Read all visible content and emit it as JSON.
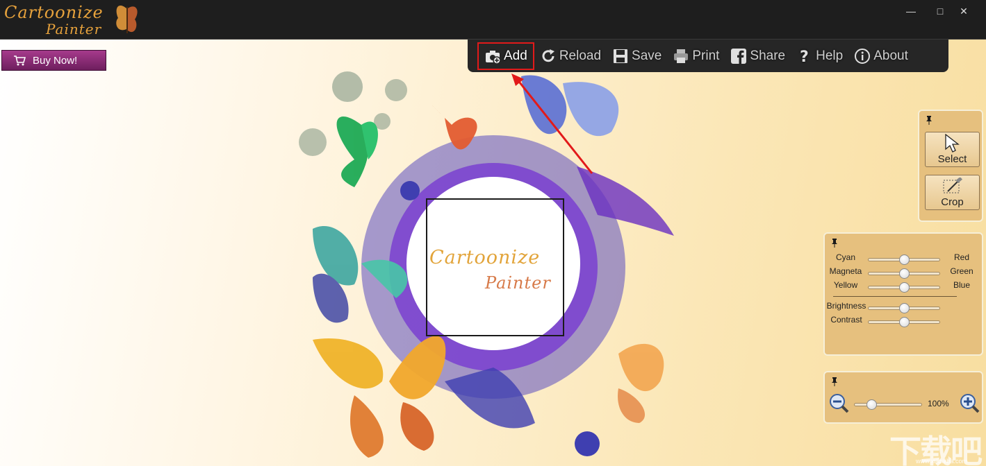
{
  "app": {
    "logo_line1": "Cartoonize",
    "logo_line2": "Painter",
    "window_controls": [
      "minimize",
      "maximize",
      "close"
    ]
  },
  "buy_button": {
    "label": "Buy Now!",
    "icon": "cart-icon"
  },
  "toolbar": {
    "items": [
      {
        "label": "Add",
        "icon": "camera-add-icon",
        "highlighted": true
      },
      {
        "label": "Reload",
        "icon": "reload-icon"
      },
      {
        "label": "Save",
        "icon": "save-icon"
      },
      {
        "label": "Print",
        "icon": "printer-icon"
      },
      {
        "label": "Share",
        "icon": "facebook-icon"
      },
      {
        "label": "Help",
        "icon": "question-icon"
      },
      {
        "label": "About",
        "icon": "info-icon"
      }
    ]
  },
  "artwork": {
    "title_line1": "Cartoonize",
    "title_line2": "Painter"
  },
  "tools_panel": {
    "select_label": "Select",
    "crop_label": "Crop"
  },
  "color_panel": {
    "sliders": [
      {
        "left": "Cyan",
        "right": "Red",
        "value": 0.5
      },
      {
        "left": "Magneta",
        "right": "Green",
        "value": 0.5
      },
      {
        "left": "Yellow",
        "right": "Blue",
        "value": 0.5
      }
    ],
    "adjust": [
      {
        "label": "Brightness",
        "value": 0.5
      },
      {
        "label": "Contrast",
        "value": 0.5
      }
    ]
  },
  "zoom_panel": {
    "zoom_text": "100%",
    "zoom_value": 0.25
  },
  "watermark": {
    "text": "下载吧",
    "sub": "www.xiazaiba.com"
  },
  "colors": {
    "accent_highlight": "#e21a1a",
    "toolbar_bg": "#262626",
    "buy_bg": "#8b2c74"
  }
}
